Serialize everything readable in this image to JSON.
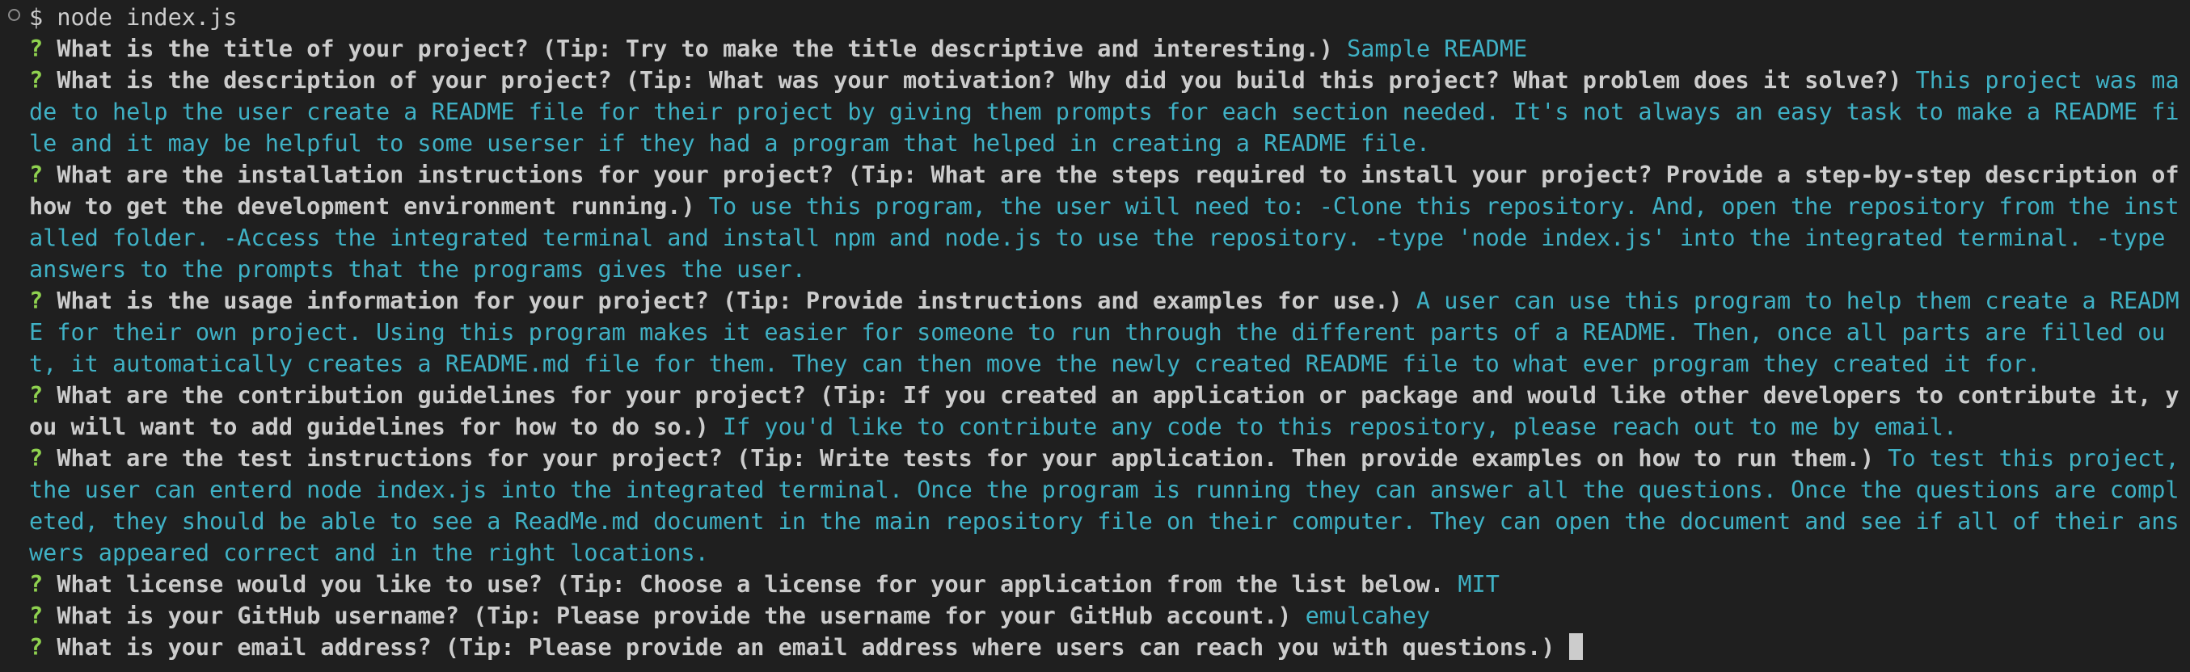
{
  "colors": {
    "background": "#1f1f1f",
    "text": "#cccccc",
    "question_mark": "#8fd14f",
    "answer": "#3fb1c5",
    "indicator": "#8b8b8b"
  },
  "command": {
    "icon": "circle-outline-icon",
    "text": "$ node index.js"
  },
  "prompts": [
    {
      "mark": "?",
      "question": "What is the title of your project? (Tip: Try to make the title descriptive and interesting.)",
      "answer": "Sample README"
    },
    {
      "mark": "?",
      "question": "What is the description of your project? (Tip: What was your motivation? Why did you build this project? What problem does it solve?)",
      "answer": "This project was made to help the user create a README file for their project by giving them prompts for each section needed. It's not always an easy task to make a README file and it may be helpful to some userser if they had a program that helped in creating a README file."
    },
    {
      "mark": "?",
      "question": "What are the installation instructions for your project? (Tip: What are the steps required to install your project? Provide a step-by-step description of how to get the development environment running.)",
      "answer": "To use this program, the user will need to: -Clone this repository. And, open the repository from the installed folder. -Access the integrated terminal and install npm and node.js to use the repository. -type 'node index.js' into the integrated terminal. -type answers to the prompts that the programs gives the user."
    },
    {
      "mark": "?",
      "question": "What is the usage information for your project? (Tip: Provide instructions and examples for use.)",
      "answer": "A user can use this program to help them create a README for their own project. Using this program makes it easier for someone to run through the different parts of a README. Then, once all parts are filled out, it automatically creates a README.md file for them. They can then move the newly created README file to what ever program they created it for."
    },
    {
      "mark": "?",
      "question": "What are the contribution guidelines for your project? (Tip: If you created an application or package and would like other developers to contribute it, you will want to add guidelines for how to do so.)",
      "answer": "If you'd like to contribute any code to this repository, please reach out to me by email."
    },
    {
      "mark": "?",
      "question": "What are the test instructions for your project? (Tip: Write tests for your application. Then provide examples on how to run them.)",
      "answer": "To test this project, the user can enterd node index.js into the integrated terminal. Once the program is running they can answer all the questions. Once the questions are completed, they should be able to see a ReadMe.md document in the main repository file on their computer. They can open the document and see if all of their answers appeared correct and in the right locations."
    },
    {
      "mark": "?",
      "question": "What license would you like to use? (Tip: Choose a license for your application from the list below.",
      "answer": "MIT"
    },
    {
      "mark": "?",
      "question": "What is your GitHub username? (Tip: Please provide the username for your GitHub account.)",
      "answer": "emulcahey"
    },
    {
      "mark": "?",
      "question": "What is your email address? (Tip: Please provide an email address where users can reach you with questions.)",
      "answer": ""
    }
  ]
}
